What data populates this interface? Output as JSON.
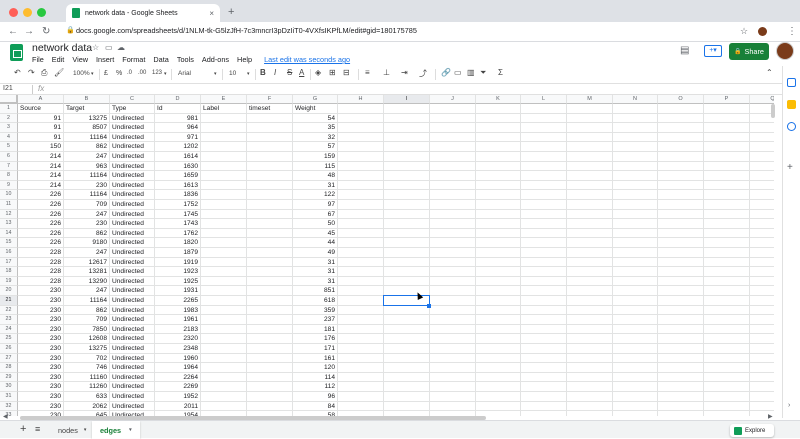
{
  "browser": {
    "tab_title": "network data - Google Sheets",
    "tab_close": "×",
    "new_tab": "+",
    "url": "docs.google.com/spreadsheets/d/1NLM-tk-G5lzJfH-7c3mncrI3pDzIiT0-4VXfsIKPfLM/edit#gid=180175785",
    "traffic_colors": [
      "#ff5f57",
      "#febc2e",
      "#28c840"
    ]
  },
  "app": {
    "doc_title": "network data",
    "menu": [
      "File",
      "Edit",
      "View",
      "Insert",
      "Format",
      "Data",
      "Tools",
      "Add-ons",
      "Help"
    ],
    "last_edit": "Last edit was seconds ago",
    "share_label": "Share",
    "accent": "#188038"
  },
  "toolbar": {
    "zoom": "100%",
    "currency": "£",
    "percent": "%",
    "dec_less": ".0",
    "dec_more": ".00",
    "more_formats": "123",
    "font": "Arial",
    "font_size": "10",
    "bold": "B",
    "italic": "I",
    "strike": "S",
    "text_color": "A",
    "sigma": "Σ"
  },
  "formula_bar": {
    "cell_ref": "I21",
    "fx": "fx"
  },
  "columns": [
    "A",
    "B",
    "C",
    "D",
    "E",
    "F",
    "G",
    "H",
    "I",
    "J",
    "K",
    "L",
    "M",
    "N",
    "O",
    "P",
    "Q"
  ],
  "header_row": [
    "Source",
    "Target",
    "Type",
    "Id",
    "Label",
    "timeset",
    "Weight"
  ],
  "rows": [
    [
      "91",
      "13275",
      "Undirected",
      "981",
      "",
      "",
      "54"
    ],
    [
      "91",
      "8507",
      "Undirected",
      "964",
      "",
      "",
      "35"
    ],
    [
      "91",
      "11164",
      "Undirected",
      "971",
      "",
      "",
      "32"
    ],
    [
      "150",
      "862",
      "Undirected",
      "1202",
      "",
      "",
      "57"
    ],
    [
      "214",
      "247",
      "Undirected",
      "1614",
      "",
      "",
      "159"
    ],
    [
      "214",
      "963",
      "Undirected",
      "1630",
      "",
      "",
      "115"
    ],
    [
      "214",
      "11164",
      "Undirected",
      "1659",
      "",
      "",
      "48"
    ],
    [
      "214",
      "230",
      "Undirected",
      "1613",
      "",
      "",
      "31"
    ],
    [
      "226",
      "11164",
      "Undirected",
      "1836",
      "",
      "",
      "122"
    ],
    [
      "226",
      "709",
      "Undirected",
      "1752",
      "",
      "",
      "97"
    ],
    [
      "226",
      "247",
      "Undirected",
      "1745",
      "",
      "",
      "67"
    ],
    [
      "226",
      "230",
      "Undirected",
      "1743",
      "",
      "",
      "50"
    ],
    [
      "226",
      "862",
      "Undirected",
      "1762",
      "",
      "",
      "45"
    ],
    [
      "226",
      "9180",
      "Undirected",
      "1820",
      "",
      "",
      "44"
    ],
    [
      "228",
      "247",
      "Undirected",
      "1879",
      "",
      "",
      "49"
    ],
    [
      "228",
      "12617",
      "Undirected",
      "1919",
      "",
      "",
      "31"
    ],
    [
      "228",
      "13281",
      "Undirected",
      "1923",
      "",
      "",
      "31"
    ],
    [
      "228",
      "13290",
      "Undirected",
      "1925",
      "",
      "",
      "31"
    ],
    [
      "230",
      "247",
      "Undirected",
      "1931",
      "",
      "",
      "851"
    ],
    [
      "230",
      "11164",
      "Undirected",
      "2265",
      "",
      "",
      "618"
    ],
    [
      "230",
      "862",
      "Undirected",
      "1983",
      "",
      "",
      "359"
    ],
    [
      "230",
      "709",
      "Undirected",
      "1961",
      "",
      "",
      "237"
    ],
    [
      "230",
      "7850",
      "Undirected",
      "2183",
      "",
      "",
      "181"
    ],
    [
      "230",
      "12608",
      "Undirected",
      "2320",
      "",
      "",
      "176"
    ],
    [
      "230",
      "13275",
      "Undirected",
      "2348",
      "",
      "",
      "171"
    ],
    [
      "230",
      "702",
      "Undirected",
      "1960",
      "",
      "",
      "161"
    ],
    [
      "230",
      "746",
      "Undirected",
      "1964",
      "",
      "",
      "120"
    ],
    [
      "230",
      "11160",
      "Undirected",
      "2264",
      "",
      "",
      "114"
    ],
    [
      "230",
      "11260",
      "Undirected",
      "2269",
      "",
      "",
      "112"
    ],
    [
      "230",
      "633",
      "Undirected",
      "1952",
      "",
      "",
      "96"
    ],
    [
      "230",
      "2062",
      "Undirected",
      "2011",
      "",
      "",
      "84"
    ],
    [
      "230",
      "645",
      "Undirected",
      "1954",
      "",
      "",
      "58"
    ]
  ],
  "sheets": {
    "add": "+",
    "list": "≡",
    "tabs": [
      "nodes",
      "edges"
    ],
    "active": "edges",
    "explore": "Explore"
  }
}
